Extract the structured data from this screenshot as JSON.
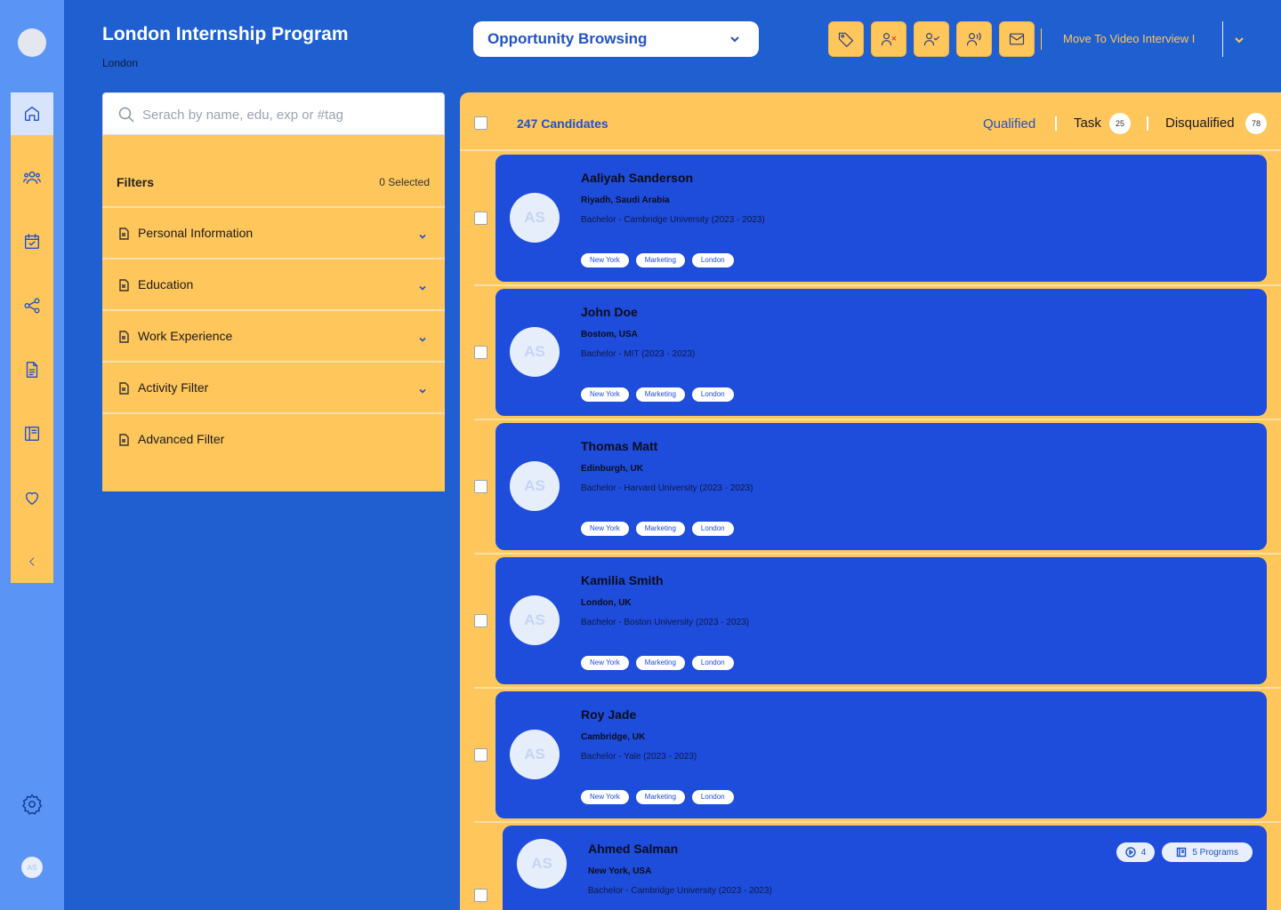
{
  "rail": {
    "avatar_initials": "AS",
    "items": [
      {
        "icon": "home-icon",
        "active": true
      },
      {
        "icon": "users-icon"
      },
      {
        "icon": "calendar-check-icon"
      },
      {
        "icon": "share-icon"
      },
      {
        "icon": "document-icon"
      },
      {
        "icon": "book-icon"
      },
      {
        "icon": "heart-icon"
      },
      {
        "icon": "chevron-left-icon"
      }
    ],
    "settings_icon": "gear-icon"
  },
  "header": {
    "title": "London Internship Program",
    "subtitle": "London",
    "stage_select": "Opportunity Browsing",
    "actions": [
      "tag-icon",
      "user-remove-icon",
      "user-check-icon",
      "user-voice-icon",
      "mail-icon"
    ],
    "move_link": "Move To Video Interview I"
  },
  "search": {
    "placeholder": "Serach by name, edu, exp or #tag"
  },
  "filters": {
    "title": "Filters",
    "selected": "0 Selected",
    "items": [
      {
        "label": "Personal Information",
        "expandable": true
      },
      {
        "label": "Education",
        "expandable": true
      },
      {
        "label": "Work Experience",
        "expandable": true
      },
      {
        "label": "Activity Filter",
        "expandable": true
      },
      {
        "label": "Advanced Filter",
        "expandable": false
      }
    ]
  },
  "candidates": {
    "count_label": "247 Candidates",
    "tabs": {
      "qualified": "Qualified",
      "task": "Task",
      "task_count": "25",
      "disqualified": "Disqualified",
      "disqualified_count": "78"
    },
    "list": [
      {
        "initials": "AS",
        "name": "Aaliyah Sanderson",
        "location": "Riyadh, Saudi Arabia",
        "education": "Bachelor - Cambridge University (2023 - 2023)",
        "tags": [
          "New York",
          "Marketing",
          "London"
        ]
      },
      {
        "initials": "AS",
        "name": "John Doe",
        "location": "Bostom, USA",
        "education": "Bachelor - MIT (2023 - 2023)",
        "tags": [
          "New York",
          "Marketing",
          "London"
        ]
      },
      {
        "initials": "AS",
        "name": "Thomas Matt",
        "location": "Edinburgh, UK",
        "education": "Bachelor - Harvard University (2023 - 2023)",
        "tags": [
          "New York",
          "Marketing",
          "London"
        ]
      },
      {
        "initials": "AS",
        "name": "Kamilia Smith",
        "location": "London, UK",
        "education": "Bachelor - Boston University (2023 - 2023)",
        "tags": [
          "New York",
          "Marketing",
          "London"
        ]
      },
      {
        "initials": "AS",
        "name": "Roy Jade",
        "location": "Cambridge,  UK",
        "education": "Bachelor - Yale (2023 - 2023)",
        "tags": [
          "New York",
          "Marketing",
          "London"
        ]
      },
      {
        "initials": "AS",
        "name": "Ahmed Salman",
        "location": "New York, USA",
        "education": "Bachelor - Cambridge University (2023 - 2023)",
        "tags": [],
        "video_count": "4",
        "programs": "5 Programs"
      }
    ]
  },
  "colors": {
    "background": "#1f5fcf",
    "accent": "#ffc65c",
    "card": "#1e4cdb",
    "rail": "#5a95f5"
  }
}
